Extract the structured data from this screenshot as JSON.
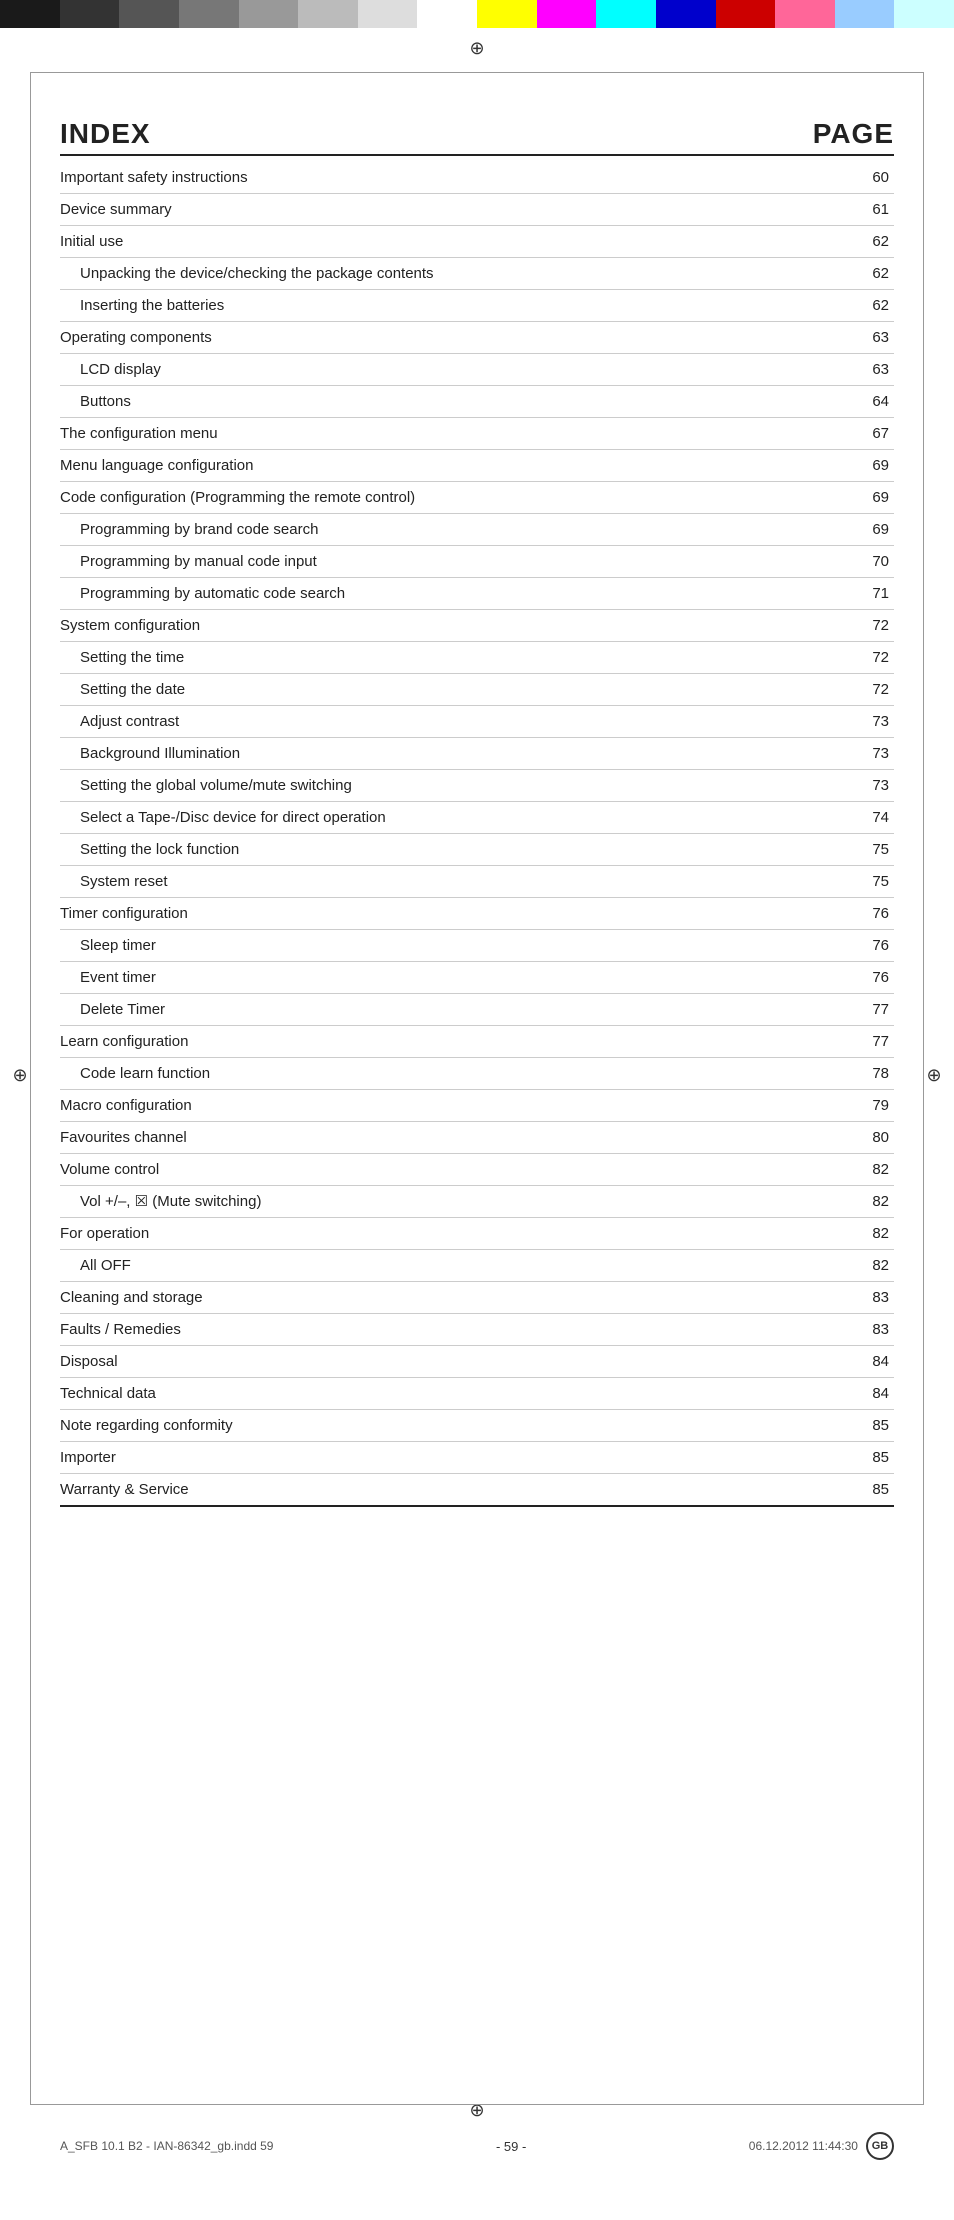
{
  "color_bar": {
    "segments": [
      "#1a1a1a",
      "#333333",
      "#555555",
      "#777777",
      "#999999",
      "#bbbbbb",
      "#dddddd",
      "#ffffff",
      "#ffff00",
      "#ff00ff",
      "#00ffff",
      "#0000cc",
      "#cc0000",
      "#ff6699",
      "#99ccff",
      "#ccffff"
    ]
  },
  "header": {
    "index_label": "INDEX",
    "page_label": "PAGE"
  },
  "table_rows": [
    {
      "label": "Important safety instructions",
      "page": "60",
      "indent": 0
    },
    {
      "label": "Device summary",
      "page": "61",
      "indent": 0
    },
    {
      "label": "Initial use",
      "page": "62",
      "indent": 0
    },
    {
      "label": "Unpacking the device/checking the package contents",
      "page": "62",
      "indent": 1
    },
    {
      "label": "Inserting the batteries",
      "page": "62",
      "indent": 1
    },
    {
      "label": "Operating components",
      "page": "63",
      "indent": 0
    },
    {
      "label": "LCD display",
      "page": "63",
      "indent": 1
    },
    {
      "label": "Buttons",
      "page": "64",
      "indent": 1
    },
    {
      "label": "The configuration menu",
      "page": "67",
      "indent": 0
    },
    {
      "label": "Menu language configuration",
      "page": "69",
      "indent": 0
    },
    {
      "label": "Code configuration (Programming the remote control)",
      "page": "69",
      "indent": 0
    },
    {
      "label": "Programming by brand code search",
      "page": "69",
      "indent": 1
    },
    {
      "label": "Programming by manual code input",
      "page": "70",
      "indent": 1
    },
    {
      "label": "Programming by automatic code search",
      "page": "71",
      "indent": 1
    },
    {
      "label": "System configuration",
      "page": "72",
      "indent": 0
    },
    {
      "label": "Setting the time",
      "page": "72",
      "indent": 1
    },
    {
      "label": "Setting the date",
      "page": "72",
      "indent": 1
    },
    {
      "label": "Adjust contrast",
      "page": "73",
      "indent": 1
    },
    {
      "label": "Background Illumination",
      "page": "73",
      "indent": 1
    },
    {
      "label": "Setting the global volume/mute switching",
      "page": "73",
      "indent": 1
    },
    {
      "label": "Select a Tape-/Disc device for direct operation",
      "page": "74",
      "indent": 1
    },
    {
      "label": "Setting the lock function",
      "page": "75",
      "indent": 1
    },
    {
      "label": "System reset",
      "page": "75",
      "indent": 1
    },
    {
      "label": "Timer configuration",
      "page": "76",
      "indent": 0
    },
    {
      "label": "Sleep timer",
      "page": "76",
      "indent": 1
    },
    {
      "label": "Event timer",
      "page": "76",
      "indent": 1
    },
    {
      "label": "Delete Timer",
      "page": "77",
      "indent": 1
    },
    {
      "label": "Learn configuration",
      "page": "77",
      "indent": 0
    },
    {
      "label": "Code learn function",
      "page": "78",
      "indent": 1
    },
    {
      "label": "Macro configuration",
      "page": "79",
      "indent": 0
    },
    {
      "label": "Favourites channel",
      "page": "80",
      "indent": 0
    },
    {
      "label": "Volume control",
      "page": "82",
      "indent": 0
    },
    {
      "label": "Vol +/–, ☒ (Mute switching)",
      "page": "82",
      "indent": 1
    },
    {
      "label": "For operation",
      "page": "82",
      "indent": 0
    },
    {
      "label": "All OFF",
      "page": "82",
      "indent": 1
    },
    {
      "label": "Cleaning and storage",
      "page": "83",
      "indent": 0
    },
    {
      "label": "Faults / Remedies",
      "page": "83",
      "indent": 0
    },
    {
      "label": "Disposal",
      "page": "84",
      "indent": 0
    },
    {
      "label": "Technical data",
      "page": "84",
      "indent": 0
    },
    {
      "label": "Note regarding conformity",
      "page": "85",
      "indent": 0
    },
    {
      "label": "Importer",
      "page": "85",
      "indent": 0
    },
    {
      "label": "Warranty & Service",
      "page": "85",
      "indent": 0
    }
  ],
  "footer": {
    "left_text": "A_SFB 10.1 B2 - IAN-86342_gb.indd  59",
    "center_text": "- 59 -",
    "right_text": "06.12.2012  11:44:30",
    "badge_text": "GB"
  },
  "crosshair_symbol": "⊕"
}
